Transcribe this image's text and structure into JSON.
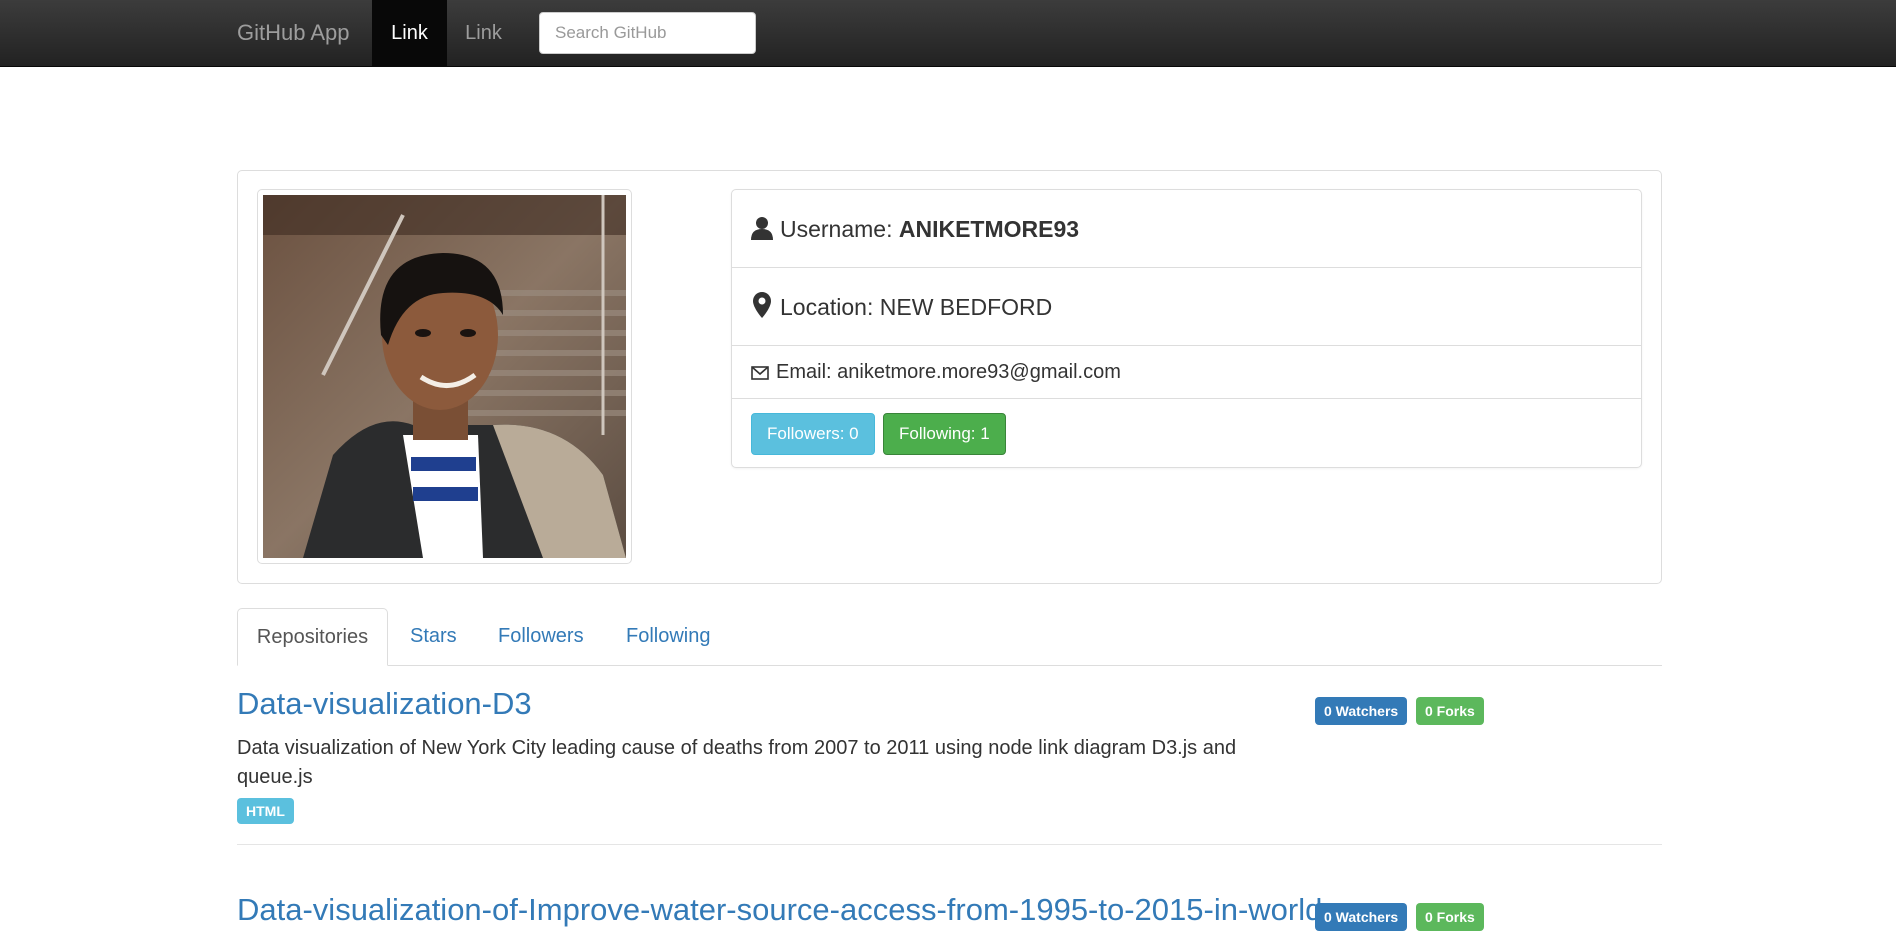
{
  "navbar": {
    "brand": "GitHub App",
    "links": [
      "Link",
      "Link"
    ],
    "search_placeholder": "Search GitHub"
  },
  "profile": {
    "username_label": "Username: ",
    "username": "ANIKETMORE93",
    "location_label": "Location: ",
    "location": "NEW BEDFORD",
    "email_label": "Email: ",
    "email": "aniketmore.more93@gmail.com",
    "followers_button": "Followers: 0",
    "following_button": "Following: 1"
  },
  "tabs": [
    "Repositories",
    "Stars",
    "Followers",
    "Following"
  ],
  "repos": [
    {
      "name": "Data-visualization-D3",
      "description": "Data visualization of New York City leading cause of deaths from 2007 to 2011 using node link diagram D3.js and queue.js",
      "language": "HTML",
      "watchers": "0 Watchers",
      "forks": "0 Forks"
    },
    {
      "name": "Data-visualization-of-Improve-water-source-access-from-1995-to-2015-in-world",
      "watchers": "0 Watchers",
      "forks": "0 Forks"
    }
  ],
  "icons": {
    "username": "user-icon",
    "location": "map-marker-icon",
    "email": "envelope-icon"
  },
  "colors": {
    "navbar": "#222222",
    "link": "#337ab7",
    "info": "#5bc0de",
    "success": "#5cb85c",
    "primary": "#337ab7"
  }
}
